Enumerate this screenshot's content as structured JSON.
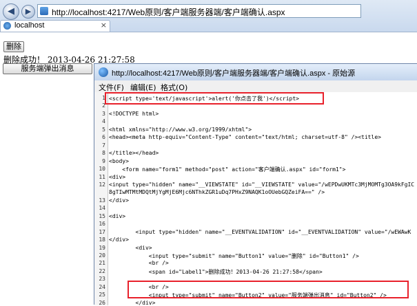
{
  "browser": {
    "address": "http://localhost:4217/Web原则/客户端服务器端/客户端确认.aspx",
    "tab_title": "localhost",
    "back_glyph": "◀",
    "forward_glyph": "▶",
    "close_glyph": "×"
  },
  "page": {
    "delete_button": "删除",
    "result_label": "删除成功！ 2013-04-26 21:27:58",
    "alert_button": "服务端弹出消息"
  },
  "source_window": {
    "title": "http://localhost:4217/Web原则/客户端服务器端/客户端确认.aspx - 原始源",
    "menu": {
      "file": "文件(F)",
      "edit": "编辑(E)",
      "format": "格式(O)"
    },
    "line_numbers": [
      "1",
      "2",
      "3",
      "4",
      "5",
      "6",
      "7",
      "8",
      "9",
      "10",
      "11",
      "12",
      "13",
      "14",
      "15",
      "16",
      "17",
      "18",
      "19",
      "20",
      "21",
      "22",
      "23",
      "24",
      "25",
      "26"
    ],
    "lines": [
      "<script type='text/javascript'>alert('你点击了我')</script>",
      "",
      "<!DOCTYPE html>",
      "",
      "<html xmlns=\"http://www.w3.org/1999/xhtml\">",
      "<head><meta http-equiv=\"Content-Type\" content=\"text/html; charset=utf-8\" /><title>",
      "",
      "</title></head>",
      "<body>",
      "    <form name=\"form1\" method=\"post\" action=\"客户端确认.aspx\" id=\"form1\">",
      "<div>",
      "<input type=\"hidden\" name=\"__VIEWSTATE\" id=\"__VIEWSTATE\" value=\"/wEPDwUKMTc3MjMOMTg3OA9kFgIC",
      "8gTIwMTMtMDQtMjYgMjE6Mjc6NThkZGR1uDq7PHxZ9NAQK1oOUebGQZeiFA==\" />",
      "</div>",
      "",
      "<div>",
      "",
      "        <input type=\"hidden\" name=\"__EVENTVALIDATION\" id=\"__EVENTVALIDATION\" value=\"/wEWAwK",
      "</div>",
      "        <div>",
      "            <input type=\"submit\" name=\"Button1\" value=\"删除\" id=\"Button1\" />",
      "            <br />",
      "            <span id=\"Label1\">删除成功！2013-04-26 21:27:58</span>",
      "",
      "            <br />",
      "            <input type=\"submit\" name=\"Button2\" value=\"服务端弹出消息\" id=\"Button2\" />",
      "        </div>"
    ]
  },
  "colors": {
    "highlight_box": "#e8202a",
    "tag": "#800000",
    "attribute": "#ff0000",
    "value": "#0000ff"
  }
}
